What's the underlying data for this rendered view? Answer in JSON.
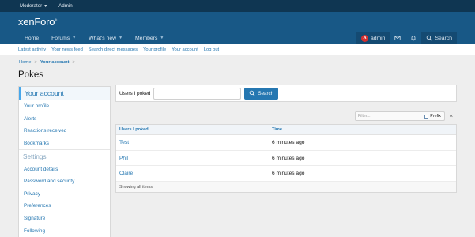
{
  "staffbar": {
    "moderator": "Moderator",
    "admin": "Admin"
  },
  "header": {
    "logo_main": "xenForo",
    "logo_reg": "®"
  },
  "nav": {
    "tabs": [
      {
        "label": "Home"
      },
      {
        "label": "Forums"
      },
      {
        "label": "What's new"
      },
      {
        "label": "Members"
      }
    ],
    "user": {
      "avatar_letter": "A",
      "username": "admin"
    },
    "search_label": "Search"
  },
  "subnav": {
    "links": [
      "Latest activity",
      "Your news feed",
      "Search direct messages",
      "Your profile",
      "Your account",
      "Log out"
    ]
  },
  "breadcrumb": {
    "home": "Home",
    "sep": ">",
    "current": "Your account"
  },
  "page_title": "Pokes",
  "sidebar": {
    "heading": "Your account",
    "items": [
      "Your profile",
      "Alerts",
      "Reactions received",
      "Bookmarks"
    ],
    "settings_heading": "Settings",
    "settings_items": [
      "Account details",
      "Password and security",
      "Privacy",
      "Preferences",
      "Signature",
      "Following"
    ]
  },
  "search_form": {
    "label": "Users I poked",
    "button": "Search"
  },
  "filter": {
    "placeholder": "Filter...",
    "prefix_label": "Prefix",
    "clear": "×"
  },
  "table": {
    "headers": [
      "Users I poked",
      "Time"
    ],
    "rows": [
      {
        "user": "Test",
        "time": "6 minutes ago"
      },
      {
        "user": "Phil",
        "time": "6 minutes ago"
      },
      {
        "user": "Claire",
        "time": "6 minutes ago"
      }
    ],
    "footer": "Showing all items"
  }
}
